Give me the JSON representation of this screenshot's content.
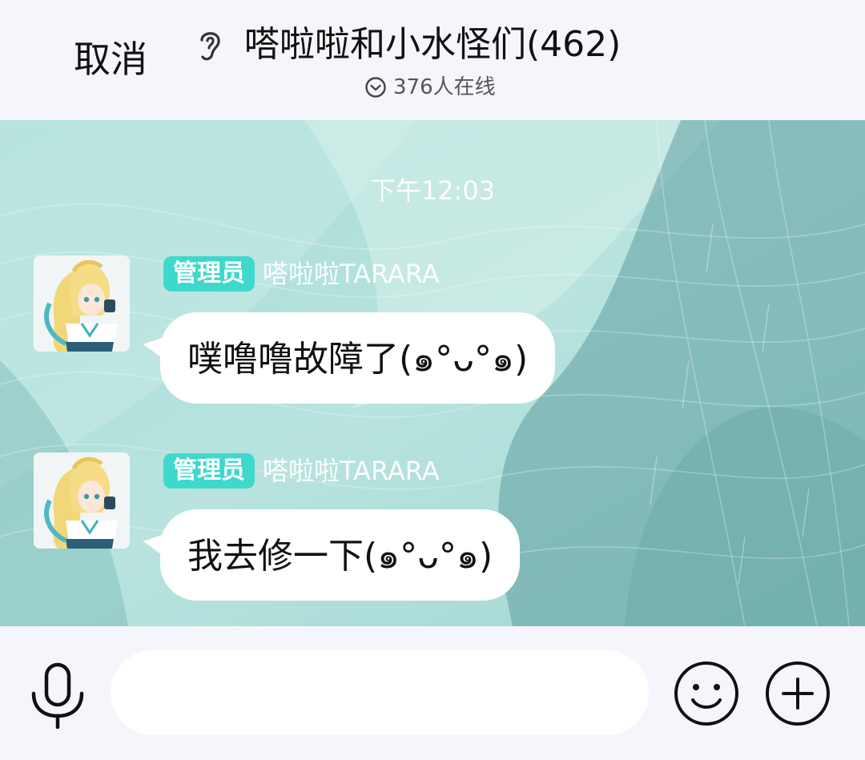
{
  "header": {
    "cancel_label": "取消",
    "title": "嗒啦啦和小水怪们(462)",
    "online": "376人在线"
  },
  "chat": {
    "timestamp": "下午12:03",
    "messages": [
      {
        "badge": "管理员",
        "sender": "嗒啦啦TARARA",
        "text": "噗噜噜故障了(๑°ᴗ°๑)"
      },
      {
        "badge": "管理员",
        "sender": "嗒啦啦TARARA",
        "text": "我去修一下(๑°ᴗ°๑)"
      }
    ]
  },
  "input": {
    "value": "",
    "placeholder": ""
  },
  "icons": {
    "header": [
      "ear-icon",
      "chevron-down-circle-icon"
    ],
    "bottom": [
      "microphone-icon",
      "smiley-icon",
      "plus-circle-icon"
    ]
  },
  "colors": {
    "admin_badge": "#3ed8cc",
    "chat_background": "#8ecfcb",
    "page_background": "#f5f6fb"
  }
}
